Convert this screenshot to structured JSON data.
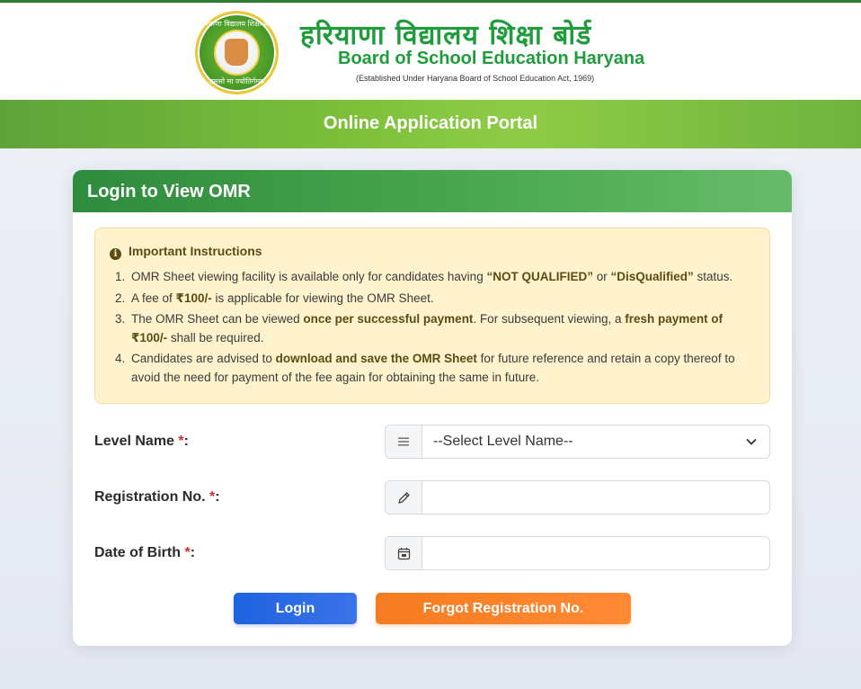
{
  "header": {
    "title_hindi": "हरियाणा विद्यालय शिक्षा बोर्ड",
    "title_english": "Board of School Education Haryana",
    "subtitle": "(Established Under Haryana Board of School Education Act, 1969)",
    "logo_text_top": "हरियाणा विद्यालय शिक्षा बोर्ड",
    "logo_text_bottom": "तमसो मा ज्योतिर्गमय"
  },
  "portal_bar": {
    "title": "Online Application Portal"
  },
  "card": {
    "title": "Login to View OMR",
    "instructions": {
      "icon": "info-icon",
      "title": "Important Instructions",
      "items": [
        {
          "num": "1.",
          "t1": "OMR Sheet viewing facility is available only for candidates having ",
          "b1": "“NOT QUALIFIED”",
          "t2": " or ",
          "b2": "“DisQualified”",
          "t3": " status."
        },
        {
          "num": "2.",
          "t1": "A fee of ",
          "b1": "₹100/-",
          "t2": " is applicable for viewing the OMR Sheet."
        },
        {
          "num": "3.",
          "t1": "The OMR Sheet can be viewed ",
          "b1": "once per successful payment",
          "t2": ". For subsequent viewing, a ",
          "b2": "fresh payment of ₹100/-",
          "t3": " shall be required."
        },
        {
          "num": "4.",
          "t1": "Candidates are advised to ",
          "b1": "download and save the OMR Sheet",
          "t2": " for future reference and retain a copy thereof to avoid the need for payment of the fee again for obtaining the same in future."
        }
      ]
    },
    "form": {
      "level_label": "Level Name ",
      "registration_label": "Registration No. ",
      "dob_label": "Date of Birth ",
      "required_mark": "*",
      "colon": ":",
      "level_selected": "--Select Level Name--",
      "registration_value": "",
      "dob_value": ""
    },
    "buttons": {
      "login": "Login",
      "forgot": "Forgot Registration No."
    }
  },
  "colors": {
    "brand_green": "#1f9c3c",
    "header_green": "#2e8b3e",
    "login_blue": "#1e63e0",
    "forgot_orange": "#f57c1f",
    "required_red": "#d32f2f",
    "alert_bg": "#fff3cd"
  }
}
